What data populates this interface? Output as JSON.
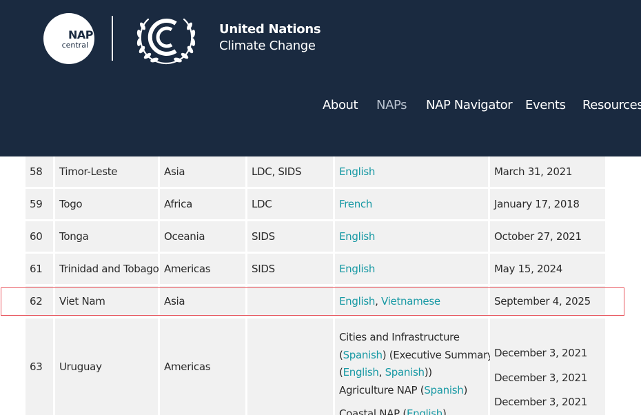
{
  "header": {
    "nap_logo": {
      "line1": "NAP",
      "line2": "central"
    },
    "un_logo": {
      "title": "United Nations",
      "subtitle": "Climate Change"
    },
    "nav": [
      {
        "label": "About",
        "active": false
      },
      {
        "label": "NAPs",
        "active": true
      },
      {
        "label": "NAP Navigator",
        "active": false
      },
      {
        "label": "Events",
        "active": false
      },
      {
        "label": "Resources",
        "active": false
      }
    ]
  },
  "colors": {
    "header_bg": "#1a2a40",
    "cell_bg": "#f1f1f1",
    "link": "#1899a4",
    "highlight_border": "#e8545c"
  },
  "table": {
    "rows": [
      {
        "no": "58",
        "country": "Timor-Leste",
        "region": "Asia",
        "group": "LDC, SIDS",
        "language": "English",
        "date": "March 31, 2021"
      },
      {
        "no": "59",
        "country": "Togo",
        "region": "Africa",
        "group": "LDC",
        "language": "French",
        "date": "January 17, 2018"
      },
      {
        "no": "60",
        "country": "Tonga",
        "region": "Oceania",
        "group": "SIDS",
        "language": "English",
        "date": "October 27, 2021"
      },
      {
        "no": "61",
        "country": "Trinidad and Tobago",
        "region": "Americas",
        "group": "SIDS",
        "language": "English",
        "date": "May 15, 2024"
      },
      {
        "no": "62",
        "country": "Viet Nam",
        "region": "Asia",
        "group": "",
        "language": "English",
        "language2": "Vietnamese",
        "date": "September 4, 2025",
        "highlighted": true
      },
      {
        "no": "63",
        "country": "Uruguay",
        "region": "Americas",
        "group": "",
        "doc1_title": "Cities and Infrastructure",
        "doc1_lang": "Spanish",
        "doc1_exec": "Executive Summary",
        "doc1_exec_lang1": "English",
        "doc1_exec_lang2": "Spanish",
        "doc2_title": "Agriculture NAP",
        "doc2_lang": "Spanish",
        "doc3_title": "Coastal NAP",
        "doc3_lang": "English",
        "dates": [
          "December 3, 2021",
          "December 3, 2021",
          "December 3, 2021"
        ]
      }
    ]
  }
}
